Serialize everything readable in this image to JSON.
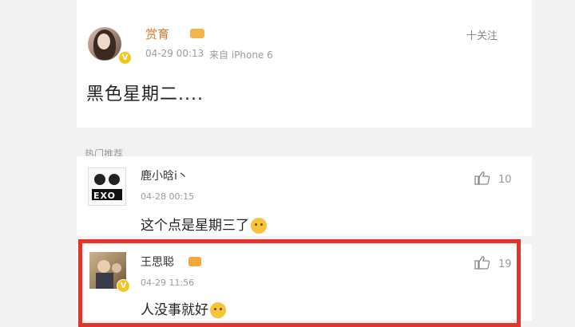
{
  "post": {
    "author": "赏育",
    "time": "04-29 00:13",
    "source": "来自 iPhone 6",
    "follow_label": "十关注",
    "text": "黑色星期二...."
  },
  "section_label": "热门推荐",
  "comments": [
    {
      "name": "鹿小晗i丶",
      "time": "04-28 00:15",
      "text": "这个点是星期三了",
      "likes": "10",
      "avatar_text": "EXO"
    },
    {
      "name": "王思聪",
      "time": "04-29 11:56",
      "text": "人没事就好",
      "likes": "19"
    }
  ],
  "colors": {
    "highlight": "#e5332a",
    "username": "#e07b2e",
    "vip": "#f5c51a"
  },
  "icons": [
    "vip-badge-icon",
    "crown-icon",
    "like-icon",
    "emoji-icon"
  ]
}
